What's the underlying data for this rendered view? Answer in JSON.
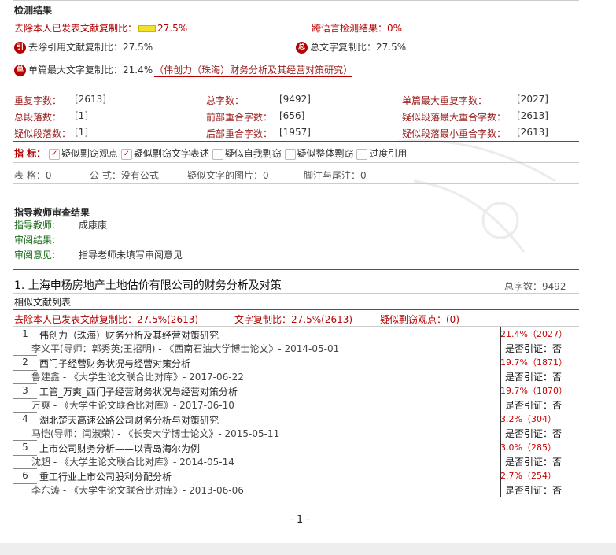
{
  "detection": {
    "title": "检测结果",
    "excl_label": "去除本人已发表文献复制比：",
    "excl_value": "27.5%",
    "cross_lang_label": "跨语言检测结果：",
    "cross_lang_value": "0%",
    "cite_label": "去除引用文献复制比：",
    "cite_value": "27.5%",
    "total_label": "总文字复制比：",
    "total_value": "27.5%",
    "max_label": "单篇最大文字复制比：",
    "max_value": "21.4%",
    "max_doc": "（伟创力（珠海）财务分析及其经营对策研究）"
  },
  "stats": [
    {
      "label": "重复字数：",
      "value": "[2613]"
    },
    {
      "label": "总字数：",
      "value": "[9492]"
    },
    {
      "label": "单篇最大重复字数：",
      "value": "[2027]"
    },
    {
      "label": "总段落数：",
      "value": "[1]"
    },
    {
      "label": "前部重合字数：",
      "value": "[656]"
    },
    {
      "label": "疑似段落最大重合字数：",
      "value": "[2613]"
    },
    {
      "label": "疑似段落数：",
      "value": "[1]"
    },
    {
      "label": "后部重合字数：",
      "value": "[1957]"
    },
    {
      "label": "疑似段落最小重合字数：",
      "value": "[2613]"
    }
  ],
  "indicators": {
    "label": "指 标：",
    "items": [
      {
        "text": "疑似剽窃观点",
        "checked": true
      },
      {
        "text": "疑似剽窃文字表述",
        "checked": true
      },
      {
        "text": "疑似自我剽窃",
        "checked": false
      },
      {
        "text": "疑似整体剽窃",
        "checked": false
      },
      {
        "text": "过度引用",
        "checked": false
      }
    ]
  },
  "misc": {
    "table": "表 格：0",
    "formula": "公 式：没有公式",
    "images": "疑似文字的图片：0",
    "notes": "脚注与尾注：0"
  },
  "advisor": {
    "title": "指导教师审查结果",
    "teacher_label": "指导教师:",
    "teacher_value": "成康康",
    "review_label": "审阅结果:",
    "opinion_label": "审阅意见:",
    "opinion_value": "指导老师未填写审阅意见"
  },
  "section": {
    "title": "1. 上海申杨房地产土地估价有限公司的财务分析及对策",
    "total": "总字数：9492",
    "similar_title": "相似文献列表",
    "excl": "去除本人已发表文献复制比：27.5%(2613)",
    "word": "文字复制比：27.5%(2613)",
    "plag": "疑似剽窃观点：(0)"
  },
  "documents": [
    {
      "num": "1",
      "title": "伟创力（珠海）财务分析及其经营对策研究",
      "source": "李义平(导师：郭秀英;王招明) - 《西南石油大学博士论文》- 2014-05-01",
      "pct": "21.4%（2027）",
      "cite": "是否引证：否"
    },
    {
      "num": "2",
      "title": "西门子经营财务状况与经营对策分析",
      "source": "鲁建鑫 - 《大学生论文联合比对库》- 2017-06-22",
      "pct": "19.7%（1871）",
      "cite": "是否引证：否"
    },
    {
      "num": "3",
      "title": "工管_万爽_西门子经营财务状况与经营对策分析",
      "source": "万爽 - 《大学生论文联合比对库》- 2017-06-10",
      "pct": "19.7%（1870）",
      "cite": "是否引证：否"
    },
    {
      "num": "4",
      "title": "湖北楚天高速公路公司财务分析与对策研究",
      "source": "马恺(导师：闫淑荣) - 《长安大学博士论文》- 2015-05-11",
      "pct": "3.2%（304）",
      "cite": "是否引证：否"
    },
    {
      "num": "5",
      "title": "上市公司财务分析——以青岛海尔为例",
      "source": "沈超 - 《大学生论文联合比对库》- 2014-05-14",
      "pct": "3.0%（285）",
      "cite": "是否引证：否"
    },
    {
      "num": "6",
      "title": "重工行业上市公司股利分配分析",
      "source": "李东涛 - 《大学生论文联合比对库》- 2013-06-06",
      "pct": "2.7%（254）",
      "cite": "是否引证：否"
    }
  ],
  "page_number": "- 1 -",
  "colors": {
    "green": "#2e6b2e",
    "red": "#b40000",
    "yellow": "#f2e12a"
  }
}
